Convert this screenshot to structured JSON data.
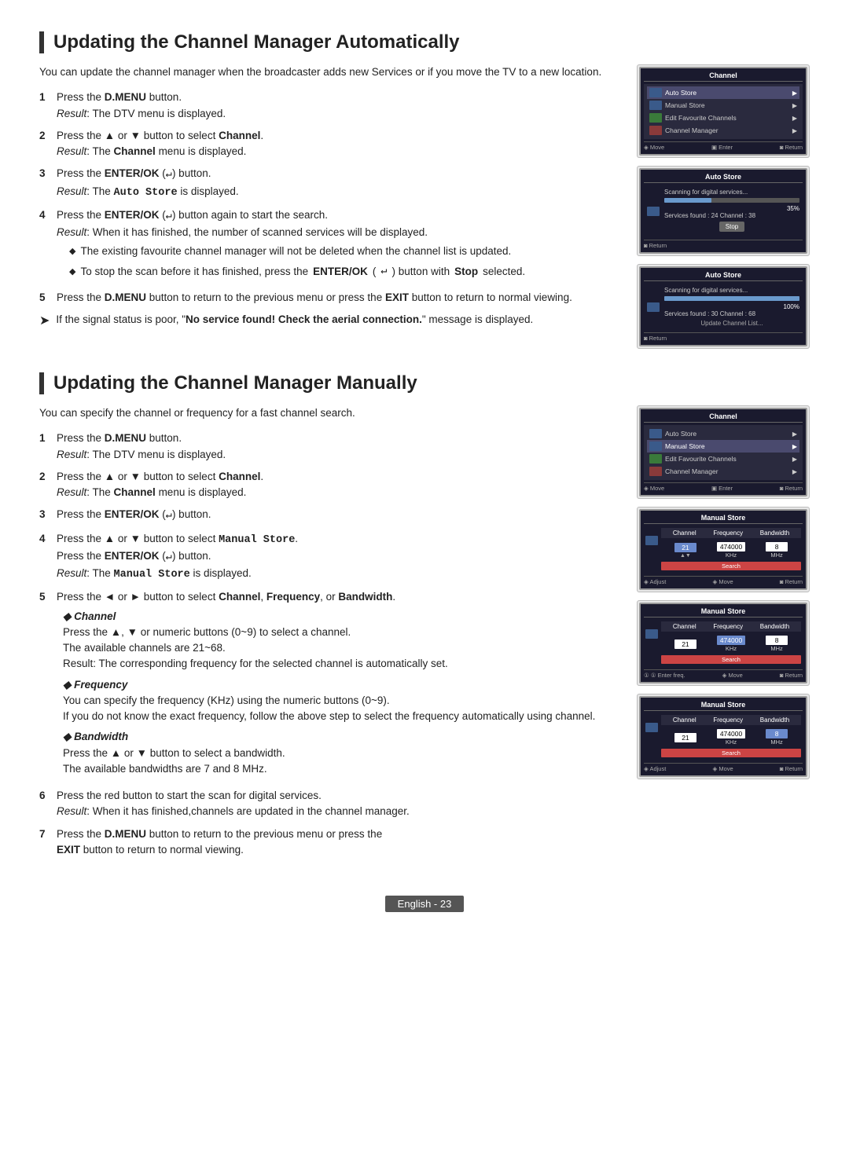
{
  "page": {
    "footer": {
      "text": "English - 23",
      "background": "#555555"
    }
  },
  "auto_section": {
    "title": "Updating the Channel Manager Automatically",
    "intro": "You can update the channel manager when the broadcaster adds new Services or if you move the TV to a new location.",
    "steps": [
      {
        "num": "1",
        "text": "Press the ",
        "bold": "D.MENU",
        "after": " button.",
        "result_label": "Result",
        "result_text": ": The DTV menu is displayed."
      },
      {
        "num": "2",
        "text": "Press the ▲ or ▼ button to select ",
        "bold": "Channel",
        "after": ".",
        "result_label": "Result",
        "result_text": ": The Channel menu is displayed."
      },
      {
        "num": "3",
        "text": "Press the ",
        "bold": "ENTER/OK",
        "enter": " (↵)",
        "after": " button.",
        "result_label": "Result",
        "result_text": ": The Auto Store is displayed."
      },
      {
        "num": "4",
        "text": "Press the ",
        "bold": "ENTER/OK",
        "enter": " (↵)",
        "after": " button again to start the search.",
        "result_label": "Result",
        "result_text": ": When it has finished, the number of scanned services will be displayed.",
        "bullets": [
          "The existing favourite channel manager will not be deleted when the channel list is updated.",
          "To stop the scan before it has finished, press the ENTER/OK (↵) button with Stop selected."
        ]
      },
      {
        "num": "5",
        "text": "Press the ",
        "bold": "D.MENU",
        "after": " button to return to the previous menu or press the ",
        "bold2": "EXIT",
        "after2": " button  to return to normal viewing."
      }
    ],
    "tip": "If the signal status is poor, \"No service found! Check the aerial connection.\" message is displayed."
  },
  "manual_section": {
    "title": "Updating the Channel Manager Manually",
    "intro": "You can specify the channel or frequency for a fast channel search.",
    "steps": [
      {
        "num": "1",
        "text": "Press the ",
        "bold": "D.MENU",
        "after": " button.",
        "result_label": "Result",
        "result_text": ": The DTV menu is displayed."
      },
      {
        "num": "2",
        "text": "Press the ▲ or ▼ button to select ",
        "bold": "Channel",
        "after": ".",
        "result_label": "Result",
        "result_text": ": The Channel menu is displayed."
      },
      {
        "num": "3",
        "text": "Press the ",
        "bold": "ENTER/OK",
        "enter": " (↵)",
        "after": " button."
      },
      {
        "num": "4",
        "text": "Press the ▲ or ▼ button to select ",
        "bold_mono": "Manual Store",
        "after": ".",
        "line2": "Press the ",
        "bold2": "ENTER/OK",
        "enter2": " (↵)",
        "after2": " button.",
        "result_label": "Result",
        "result_text": ": The Manual Store is displayed."
      },
      {
        "num": "5",
        "text": "Press the ◄ or ► button to select ",
        "bold": "Channel",
        "sep1": ", ",
        "bold2": "Frequency",
        "sep2": ", or ",
        "bold3": "Bandwidth",
        "after": ".",
        "sub_bullets": [
          {
            "title": "Channel",
            "lines": [
              "Press the ▲, ▼ or numeric buttons (0~9) to select a channel.",
              "The available channels are 21~68.",
              "Result: The corresponding frequency for the selected channel is automatically set."
            ]
          },
          {
            "title": "Frequency",
            "lines": [
              "You can specify the frequency (KHz) using the numeric buttons (0~9).",
              "If you do not know the exact frequency, follow the above step to select the frequency automatically using channel."
            ]
          },
          {
            "title": "Bandwidth",
            "lines": [
              "Press the ▲ or ▼ button to select a bandwidth.",
              "The available bandwidths are 7 and 8 MHz."
            ]
          }
        ]
      },
      {
        "num": "6",
        "text": "Press the red button to start the scan for digital services.",
        "result_label": "Result",
        "result_text": ": When it has finished,channels are updated in the channel manager."
      },
      {
        "num": "7",
        "text": "Press the ",
        "bold": "D.MENU",
        "after": " button to return to the previous menu or press the ",
        "bold2": "EXIT",
        "after2": " button to return to normal viewing."
      }
    ]
  },
  "screens": {
    "auto": [
      {
        "title": "Channel",
        "type": "channel_menu",
        "items": [
          "Auto Store",
          "Manual Store",
          "Edit Favourite Channels",
          "Channel Manager"
        ],
        "selected": 0,
        "nav": "◈ Move  ▣ Enter  ◙ Return"
      },
      {
        "title": "Auto Store",
        "type": "scan",
        "scanning_text": "Scanning for digital services...",
        "progress": 35,
        "progress_label": "35%",
        "info": "Services found : 24   Channel : 38",
        "button": "Stop",
        "nav": "◙ Return"
      },
      {
        "title": "Auto Store",
        "type": "scan_complete",
        "scanning_text": "Scanning for digital services...",
        "progress": 100,
        "progress_label": "100%",
        "info": "Services found : 30   Channel : 68",
        "update_text": "Update Channel List...",
        "nav": "◙ Return"
      }
    ],
    "manual": [
      {
        "title": "Channel",
        "type": "channel_menu",
        "items": [
          "Auto Store",
          "Manual Store",
          "Edit Favourite Channels",
          "Channel Manager"
        ],
        "selected": 1,
        "nav": "◈ Move  ▣ Enter  ◙ Return"
      },
      {
        "title": "Manual Store",
        "type": "manual_store",
        "headers": [
          "Channel",
          "Frequency",
          "Bandwidth"
        ],
        "values": [
          "21",
          "474000",
          "8"
        ],
        "units": [
          "",
          "KHz",
          "MHz"
        ],
        "button": "Search",
        "nav": "◈ Adjust  ◈ Move  ◙ Return"
      },
      {
        "title": "Manual Store",
        "type": "manual_store",
        "headers": [
          "Channel",
          "Frequency",
          "Bandwidth"
        ],
        "values": [
          "21",
          "474000",
          "8"
        ],
        "units": [
          "",
          "KHz",
          "MHz"
        ],
        "button": "Search",
        "nav": "① ① Enter freq. ◈ Move ◙ Return"
      },
      {
        "title": "Manual Store",
        "type": "manual_store_highlight",
        "headers": [
          "Channel",
          "Frequency",
          "Bandwidth"
        ],
        "values": [
          "21",
          "474000",
          "8"
        ],
        "units": [
          "",
          "KHz",
          "MHz"
        ],
        "highlight": 2,
        "button": "Search",
        "nav": "◈ Adjust  ◈ Move  ◙ Return"
      }
    ]
  }
}
